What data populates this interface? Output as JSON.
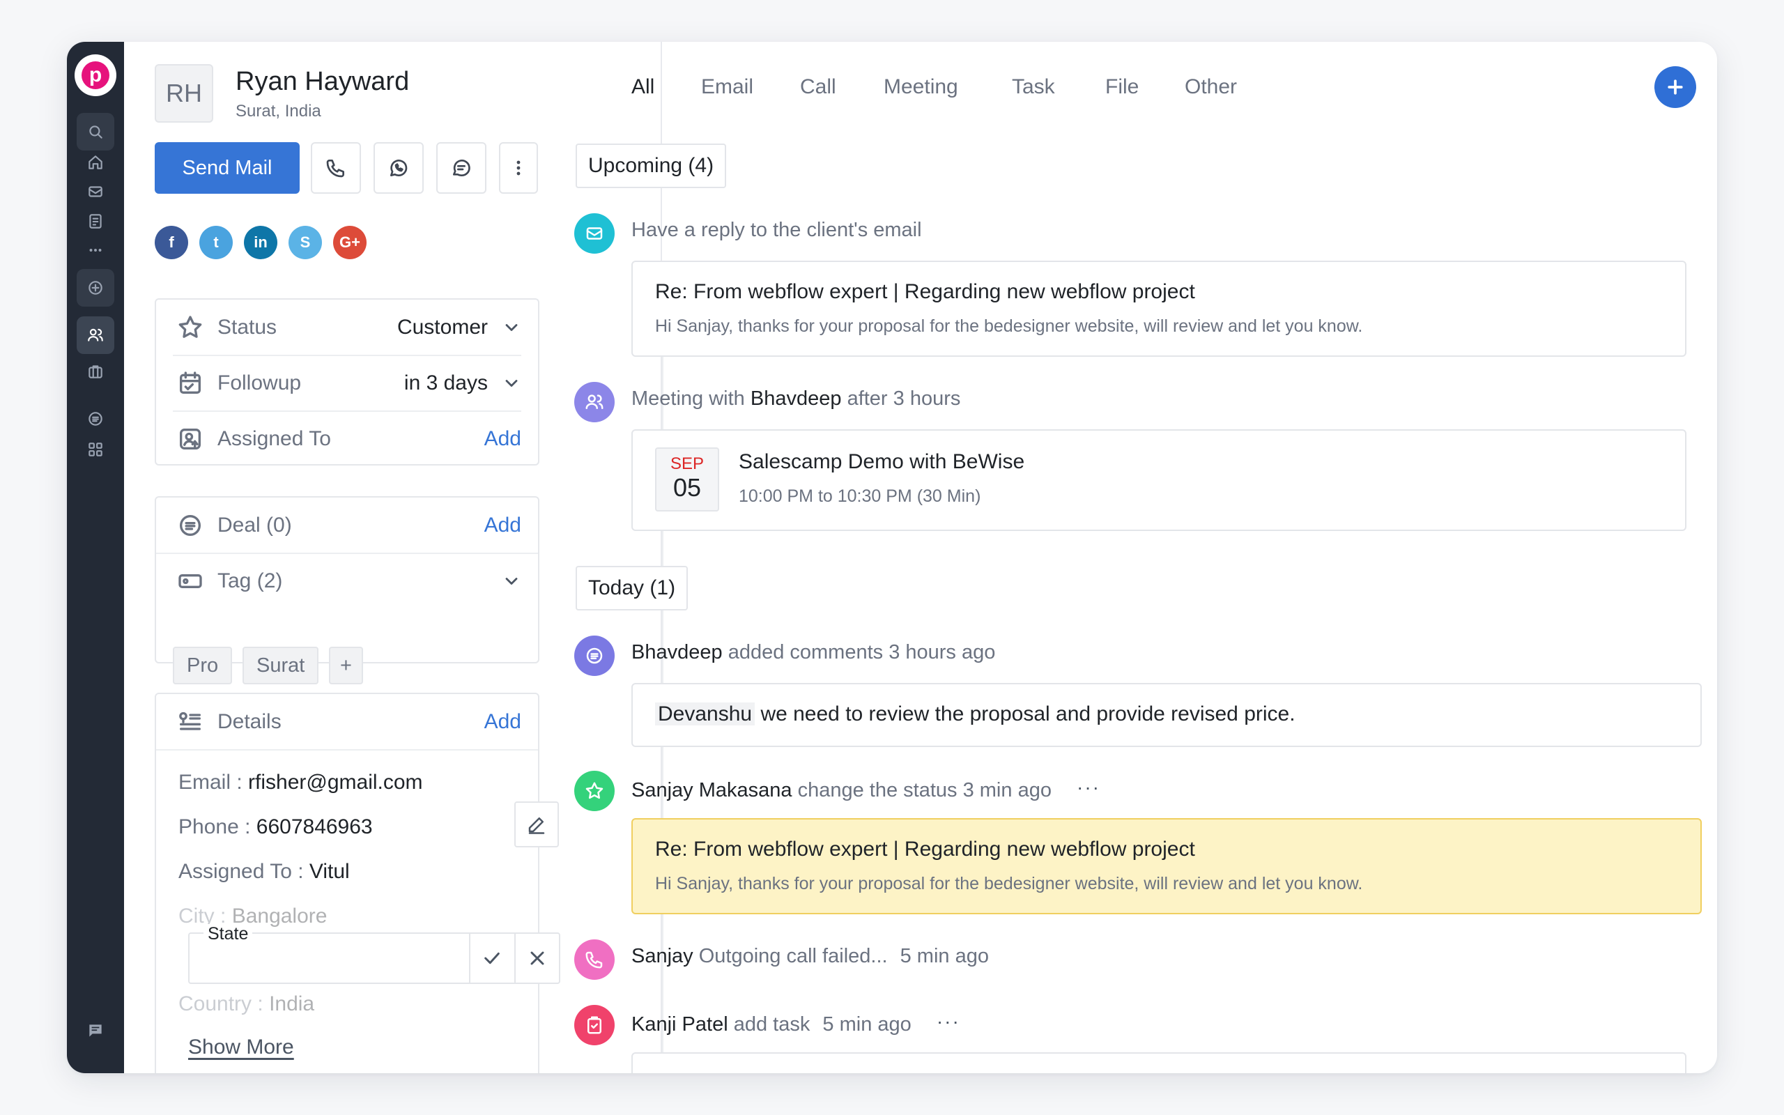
{
  "brand": {
    "letter": "p",
    "color": "#e6127c"
  },
  "sidebar": {
    "items": [
      {
        "name": "search",
        "icon": "search-icon"
      },
      {
        "name": "home",
        "icon": "home-icon"
      },
      {
        "name": "mail",
        "icon": "mail-icon"
      },
      {
        "name": "notes",
        "icon": "clipboard-icon"
      },
      {
        "name": "more",
        "icon": "more-horizontal-icon"
      },
      {
        "name": "add",
        "icon": "plus-circle-icon"
      },
      {
        "name": "contacts",
        "icon": "users-icon",
        "active": true
      },
      {
        "name": "deals",
        "icon": "briefcase-icon"
      },
      {
        "name": "lists",
        "icon": "list-circle-icon"
      },
      {
        "name": "apps",
        "icon": "grid-icon"
      },
      {
        "name": "chat",
        "icon": "chat-icon"
      }
    ]
  },
  "contact": {
    "initials": "RH",
    "name": "Ryan Hayward",
    "location": "Surat, India"
  },
  "actions": {
    "send_mail": "Send Mail",
    "icons": [
      "phone-icon",
      "whatsapp-icon",
      "message-icon",
      "kebab-menu-icon"
    ]
  },
  "social": [
    {
      "name": "facebook",
      "label": "f",
      "color": "#3b5998"
    },
    {
      "name": "twitter",
      "label": "t",
      "color": "#4aa3df"
    },
    {
      "name": "linkedin",
      "label": "in",
      "color": "#0e76a8"
    },
    {
      "name": "skype",
      "label": "S",
      "color": "#5bb3e6"
    },
    {
      "name": "google-plus",
      "label": "G+",
      "color": "#dd4b39"
    }
  ],
  "info": {
    "status": {
      "label": "Status",
      "value": "Customer"
    },
    "followup": {
      "label": "Followup",
      "value": "in 3 days"
    },
    "assigned": {
      "label": "Assigned To",
      "action": "Add"
    }
  },
  "deal": {
    "label": "Deal (0)",
    "action": "Add"
  },
  "tags": {
    "label": "Tag (2)",
    "items": [
      "Pro",
      "Surat"
    ],
    "add": "+"
  },
  "details": {
    "label": "Details",
    "action": "Add",
    "email_key": "Email :",
    "email": "rfisher@gmail.com",
    "phone_key": "Phone :",
    "phone": "6607846963",
    "assigned_key": "Assigned To :",
    "assigned": "Vitul",
    "city_key": "City :",
    "city": "Bangalore",
    "country_key": "Country :",
    "country": "India",
    "state_label": "State",
    "state_value": "",
    "show_more": "Show More"
  },
  "tabs": [
    "All",
    "Email",
    "Call",
    "Meeting",
    "Task",
    "File",
    "Other"
  ],
  "active_tab": "All",
  "timeline": {
    "upcoming_label": "Upcoming (4)",
    "today_label": "Today (1)",
    "email_item": {
      "text": "Have a reply to the client's email",
      "subject": "Re: From webflow expert | Regarding new webflow project",
      "body": "Hi Sanjay, thanks for your proposal for the bedesigner website, will review and let you know."
    },
    "meeting_item": {
      "prefix": "Meeting with",
      "person": "Bhavdeep",
      "suffix": "after 3 hours",
      "month": "SEP",
      "day": "05",
      "title": "Salescamp Demo with BeWise",
      "time": "10:00 PM to 10:30 PM (30 Min)"
    },
    "comment_item": {
      "person": "Bhavdeep",
      "text": "added comments 3 hours ago",
      "mention": "Devanshu",
      "comment": "we need to review the proposal and provide revised price."
    },
    "status_item": {
      "person": "Sanjay Makasana",
      "text": "change the status 3 min ago",
      "subject": "Re: From webflow expert | Regarding new webflow project",
      "body": "Hi Sanjay, thanks for your proposal for the bedesigner website, will review and let you know."
    },
    "call_item": {
      "person": "Sanjay",
      "text": "Outgoing call failed...",
      "time": "5 min ago"
    },
    "task_item": {
      "person": "Kanji Patel",
      "text": "add task",
      "time": "5 min ago"
    },
    "more_dots": "···"
  },
  "colors": {
    "primary": "#3675d6",
    "email_dot": "#1fc0d4",
    "meeting_dot": "#8c86e8",
    "comment_dot": "#7b79e3",
    "status_dot": "#34d27b",
    "call_dot": "#f06fc2",
    "task_dot": "#f0426b",
    "highlight": "#fdf3c6"
  }
}
